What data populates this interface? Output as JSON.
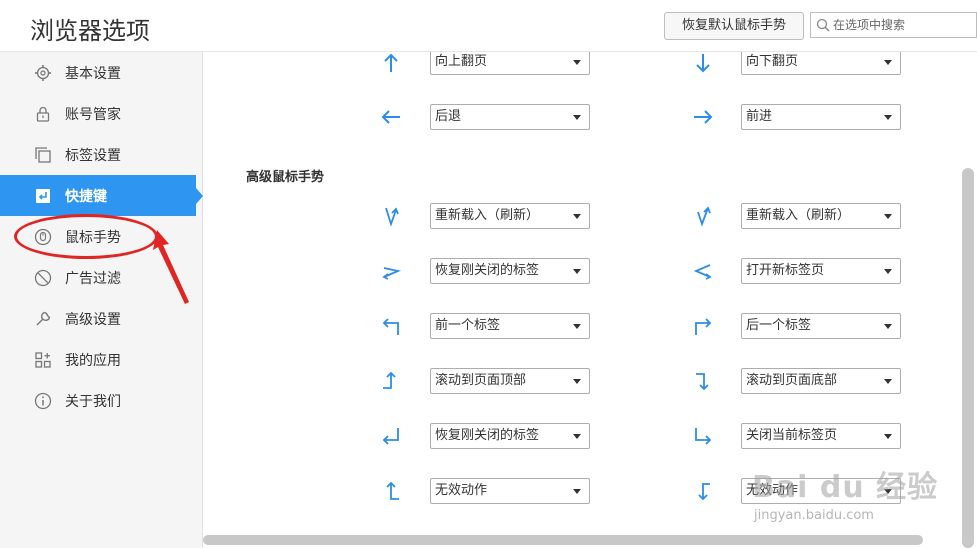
{
  "header": {
    "title": "浏览器选项",
    "restore_button": "恢复默认鼠标手势",
    "search_placeholder": "在选项中搜索"
  },
  "sidebar": {
    "items": [
      {
        "label": "基本设置",
        "icon": "gear-icon"
      },
      {
        "label": "账号管家",
        "icon": "lock-icon"
      },
      {
        "label": "标签设置",
        "icon": "tabs-icon"
      },
      {
        "label": "快捷键",
        "icon": "shortcut-icon",
        "active": true
      },
      {
        "label": "鼠标手势",
        "icon": "mouse-icon"
      },
      {
        "label": "广告过滤",
        "icon": "block-icon"
      },
      {
        "label": "高级设置",
        "icon": "wrench-icon"
      },
      {
        "label": "我的应用",
        "icon": "apps-icon"
      },
      {
        "label": "关于我们",
        "icon": "info-icon"
      }
    ]
  },
  "gestures": {
    "basic": [
      {
        "left": {
          "icon": "arrow-up-icon",
          "value": "向上翻页"
        },
        "right": {
          "icon": "arrow-down-icon",
          "value": "向下翻页"
        }
      },
      {
        "left": {
          "icon": "arrow-left-icon",
          "value": "后退"
        },
        "right": {
          "icon": "arrow-right-icon",
          "value": "前进"
        }
      }
    ],
    "advanced_title": "高级鼠标手势",
    "advanced": [
      {
        "left": {
          "icon": "gesture-down-up-icon",
          "value": "重新载入（刷新）"
        },
        "right": {
          "icon": "gesture-up-down-icon",
          "value": "重新载入（刷新）"
        }
      },
      {
        "left": {
          "icon": "gesture-right-left-icon",
          "value": "恢复刚关闭的标签"
        },
        "right": {
          "icon": "gesture-left-right-icon",
          "value": "打开新标签页"
        }
      },
      {
        "left": {
          "icon": "gesture-up-left-icon",
          "value": "前一个标签"
        },
        "right": {
          "icon": "gesture-up-right-icon",
          "value": "后一个标签"
        }
      },
      {
        "left": {
          "icon": "gesture-left-up-icon",
          "value": "滚动到页面顶部"
        },
        "right": {
          "icon": "gesture-right-down-icon",
          "value": "滚动到页面底部"
        }
      },
      {
        "left": {
          "icon": "gesture-down-left-icon",
          "value": "恢复刚关闭的标签"
        },
        "right": {
          "icon": "gesture-down-right-icon",
          "value": "关闭当前标签页"
        }
      },
      {
        "left": {
          "icon": "gesture-right-up-icon",
          "value": "无效动作"
        },
        "right": {
          "icon": "gesture-left-down-icon",
          "value": "无效动作"
        }
      }
    ]
  },
  "watermark": {
    "brand": "Bai du 经验",
    "site": "jingyan.baidu.com"
  },
  "colors": {
    "accent": "#2e96f0",
    "annotation": "#e12424"
  }
}
